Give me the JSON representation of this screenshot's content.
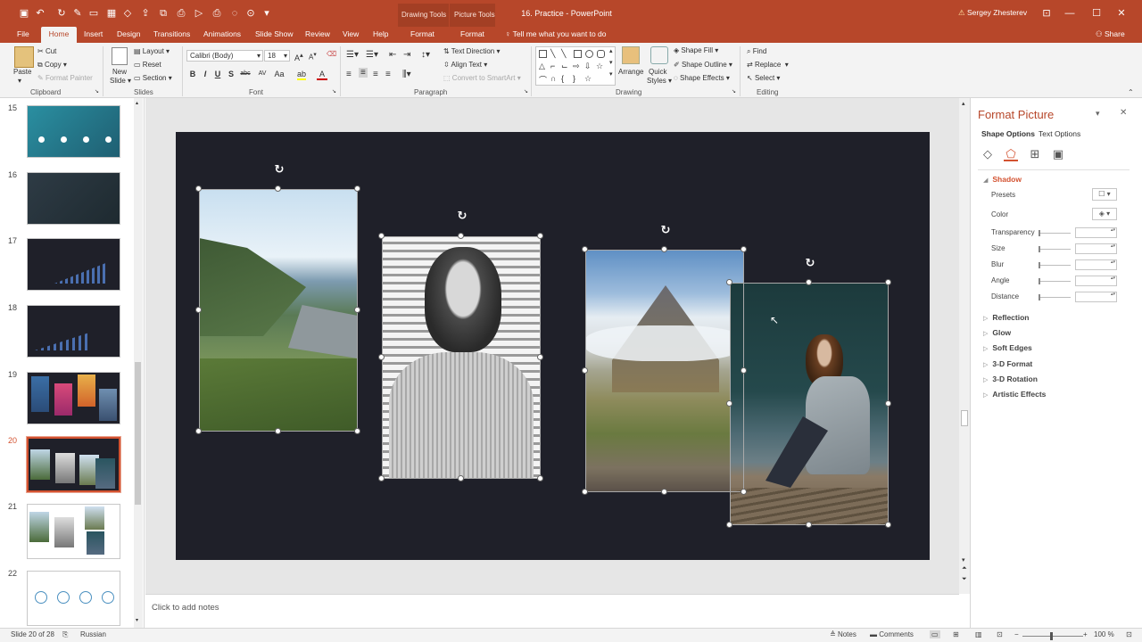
{
  "titlebar": {
    "document_title": "16. Practice  -  PowerPoint",
    "context_group_drawing": "Drawing Tools",
    "context_group_picture": "Picture Tools",
    "user_name": "Sergey Zhesterev",
    "warning_icon": "warning-icon",
    "quick_access_icons": [
      "save-icon",
      "undo-icon",
      "redo-icon",
      "format-painter-icon",
      "slide-icon",
      "table-icon",
      "shape-icon",
      "share-icon",
      "screenshot-icon",
      "print-icon",
      "present-icon",
      "more-icon"
    ],
    "window_controls": [
      "ribbon-display-icon",
      "minimize-icon",
      "maximize-icon",
      "close-icon"
    ]
  },
  "tabs": {
    "items": [
      "File",
      "Home",
      "Insert",
      "Design",
      "Transitions",
      "Animations",
      "Slide Show",
      "Review",
      "View",
      "Help",
      "Format",
      "Format"
    ],
    "active": "Home",
    "tell_me": "Tell me what you want to do",
    "share": "Share"
  },
  "ribbon": {
    "clipboard": {
      "paste": "Paste",
      "cut": "Cut",
      "copy": "Copy",
      "format_painter": "Format Painter",
      "label": "Clipboard"
    },
    "slides": {
      "new_slide_line1": "New",
      "new_slide_line2": "Slide",
      "layout": "Layout",
      "reset": "Reset",
      "section": "Section",
      "label": "Slides"
    },
    "font": {
      "font_name": "Calibri (Body)",
      "font_size": "18",
      "buttons": [
        "B",
        "I",
        "U",
        "S",
        "abc",
        "AV",
        "Aa",
        "A"
      ],
      "label": "Font"
    },
    "paragraph": {
      "text_direction": "Text Direction",
      "align_text": "Align Text",
      "convert_smartart": "Convert to SmartArt",
      "label": "Paragraph"
    },
    "drawing": {
      "arrange": "Arrange",
      "quick_styles_line1": "Quick",
      "quick_styles_line2": "Styles",
      "shape_fill": "Shape Fill",
      "shape_outline": "Shape Outline",
      "shape_effects": "Shape Effects",
      "label": "Drawing"
    },
    "editing": {
      "find": "Find",
      "replace": "Replace",
      "select": "Select",
      "label": "Editing"
    }
  },
  "slides_panel": {
    "numbers": [
      "15",
      "16",
      "17",
      "18",
      "19",
      "20",
      "21",
      "22"
    ],
    "selected": "20"
  },
  "notes_placeholder": "Click to add notes",
  "format_pane": {
    "title": "Format Picture",
    "tabs": [
      "Shape Options",
      "Text Options"
    ],
    "icons": [
      "fill-line-icon",
      "effects-icon",
      "size-properties-icon",
      "picture-icon"
    ],
    "shadow": {
      "title": "Shadow",
      "presets": "Presets",
      "color": "Color",
      "transparency": "Transparency",
      "size": "Size",
      "blur": "Blur",
      "angle": "Angle",
      "distance": "Distance"
    },
    "sections": [
      "Reflection",
      "Glow",
      "Soft Edges",
      "3-D Format",
      "3-D Rotation",
      "Artistic Effects"
    ]
  },
  "status": {
    "slide_info": "Slide 20 of 28",
    "language": "Russian",
    "notes": "Notes",
    "comments": "Comments",
    "zoom": "100 %"
  }
}
